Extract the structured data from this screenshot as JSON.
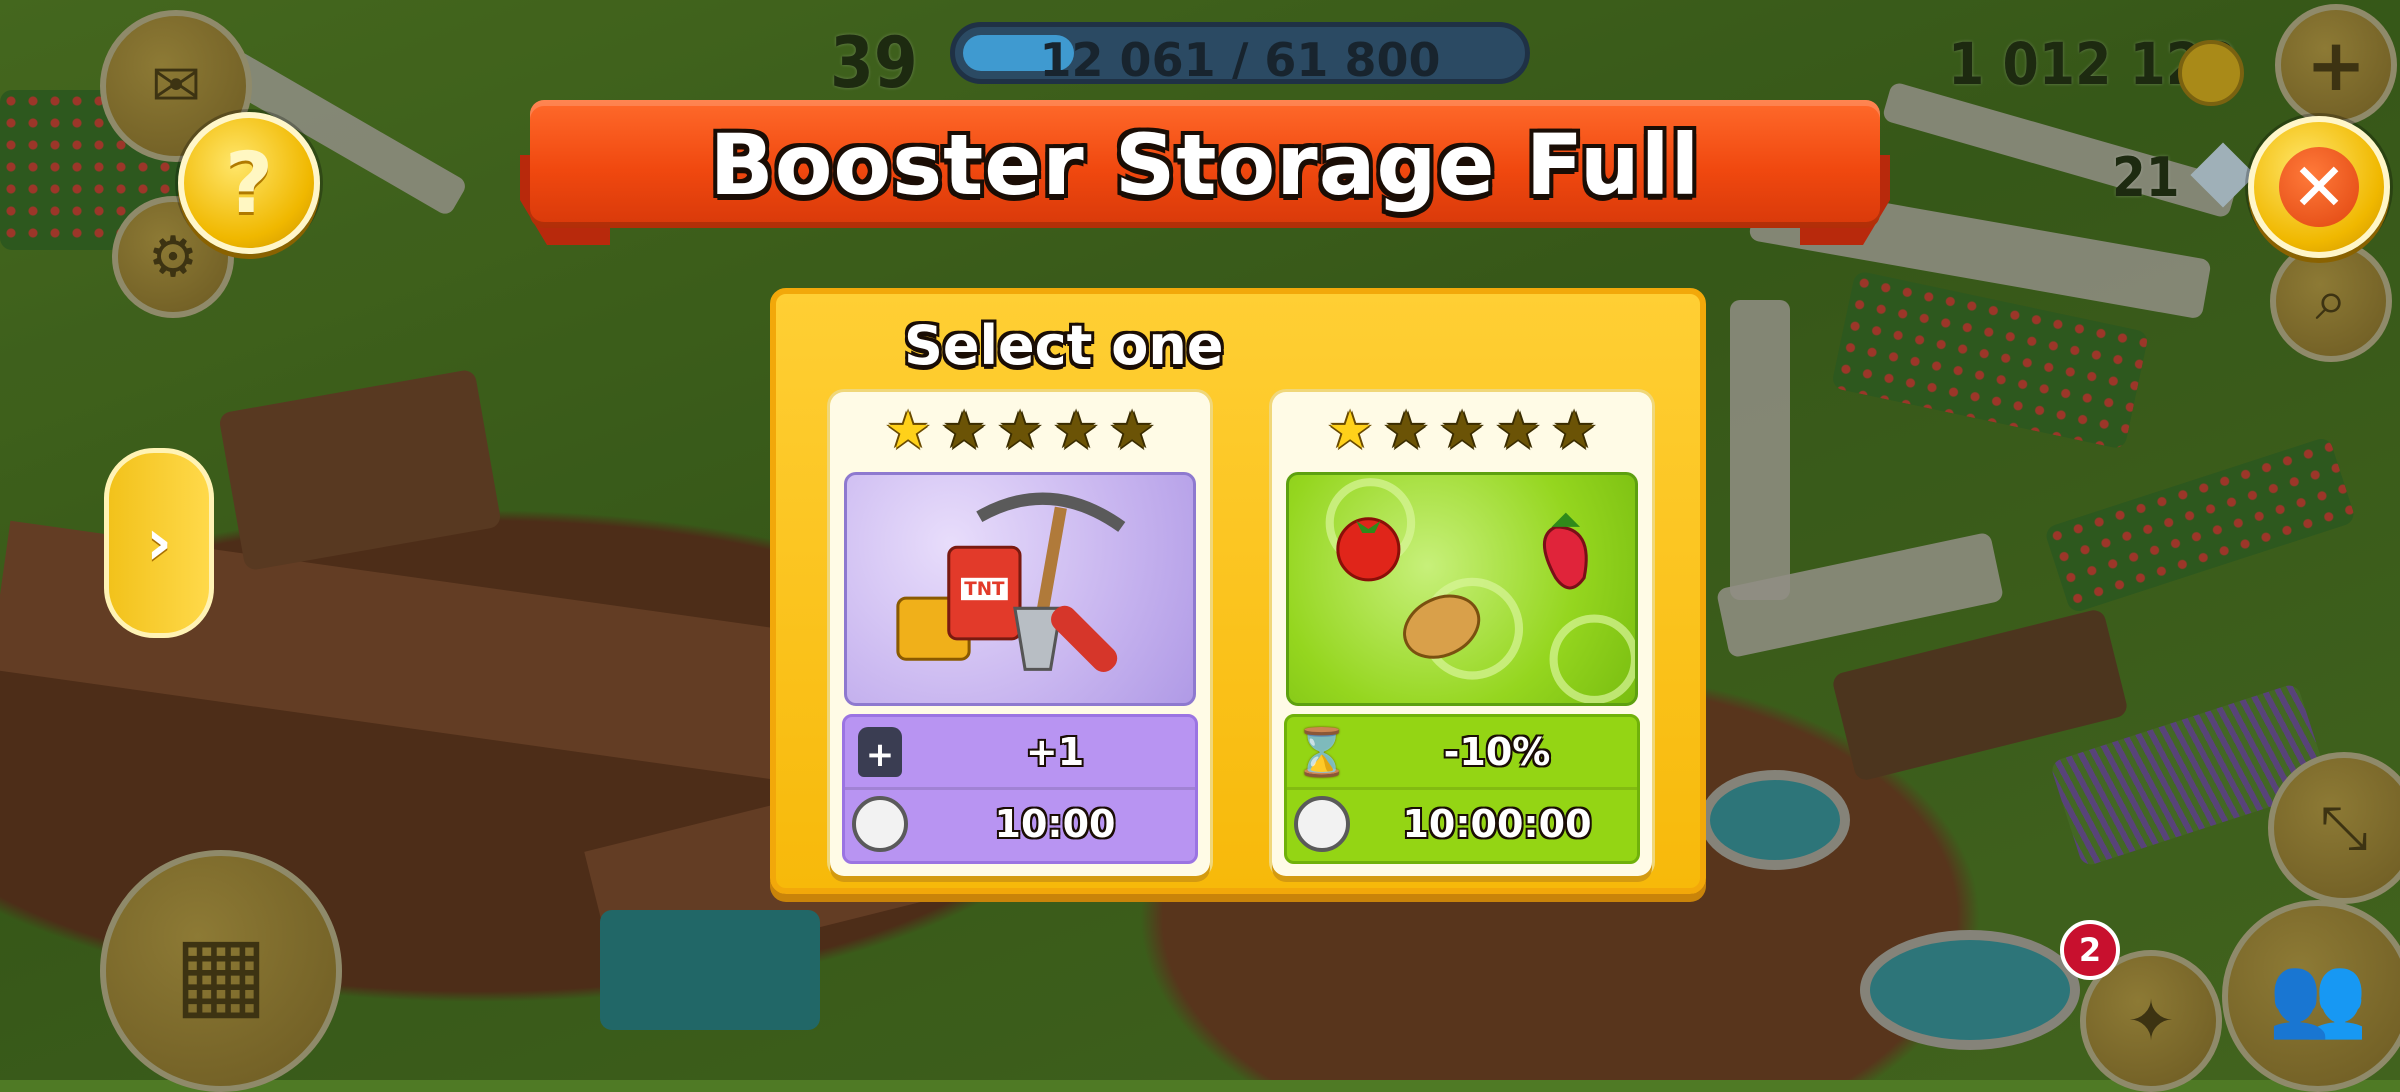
{
  "hud": {
    "level": "39",
    "xp_text": "12 061 / 61 800",
    "xp_progress": 0.195,
    "coins": "1 012 129",
    "diamonds": "21",
    "notification_count": "2"
  },
  "dialog": {
    "title": "Booster Storage Full",
    "subtitle": "Select one",
    "options": [
      {
        "stars_filled": 1,
        "stars_total": 5,
        "theme_color": "#b894f2",
        "effect_icon": "storage-weight-icon",
        "effect_value": "+1",
        "timer_icon": "stopwatch-icon",
        "duration": "10:00"
      },
      {
        "stars_filled": 1,
        "stars_total": 5,
        "theme_color": "#94d514",
        "effect_icon": "hourglass-icon",
        "effect_value": "-10%",
        "timer_icon": "stopwatch-icon",
        "duration": "10:00:00"
      }
    ]
  },
  "colors": {
    "banner": "#f0480f",
    "panel": "#ffcf34",
    "button_gold": "#f0b800"
  }
}
